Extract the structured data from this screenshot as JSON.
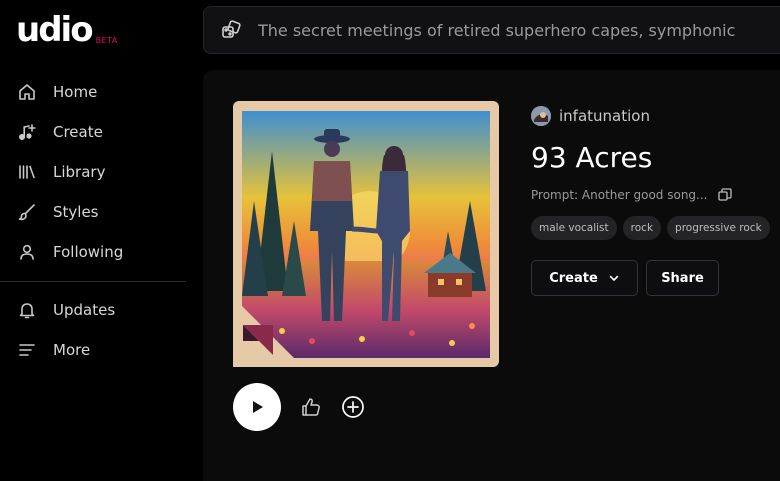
{
  "brand": {
    "name": "udio",
    "badge": "BETA",
    "accent": "#e30a5c"
  },
  "sidebar": {
    "items": [
      {
        "label": "Home",
        "icon": "home-icon"
      },
      {
        "label": "Create",
        "icon": "music-plus-icon"
      },
      {
        "label": "Library",
        "icon": "library-icon"
      },
      {
        "label": "Styles",
        "icon": "brush-icon"
      },
      {
        "label": "Following",
        "icon": "user-icon"
      }
    ],
    "secondary": [
      {
        "label": "Updates",
        "icon": "bell-icon"
      },
      {
        "label": "More",
        "icon": "menu-icon"
      }
    ]
  },
  "search": {
    "icon": "dice-icon",
    "text": "The secret meetings of retired superhero capes,  symphonic"
  },
  "song": {
    "artist": "infatunation",
    "title": "93 Acres",
    "prompt": "Prompt: Another good song...",
    "tags": [
      "male vocalist",
      "rock",
      "progressive rock"
    ],
    "create_label": "Create",
    "share_label": "Share"
  },
  "colors": {
    "background": "#000000",
    "panel": "#0b0b0c",
    "art_frame": "#e6c9a6"
  }
}
